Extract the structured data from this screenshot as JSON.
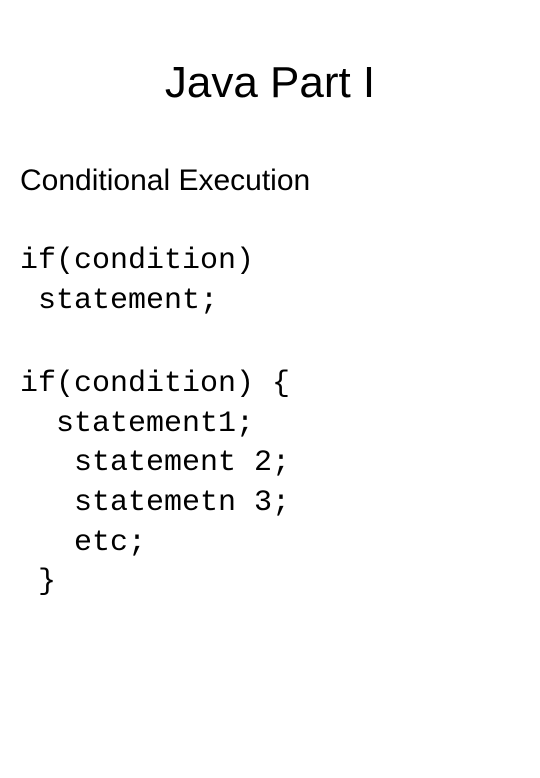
{
  "title": "Java Part I",
  "subtitle": "Conditional Execution",
  "code1_line1": "if(condition)",
  "code1_line2": " statement;",
  "code2_line1": "if(condition) {",
  "code2_line2": "  statement1;",
  "code2_line3": "   statement 2;",
  "code2_line4": "   statemetn 3;",
  "code2_line5": "   etc;",
  "code2_line6": " }"
}
